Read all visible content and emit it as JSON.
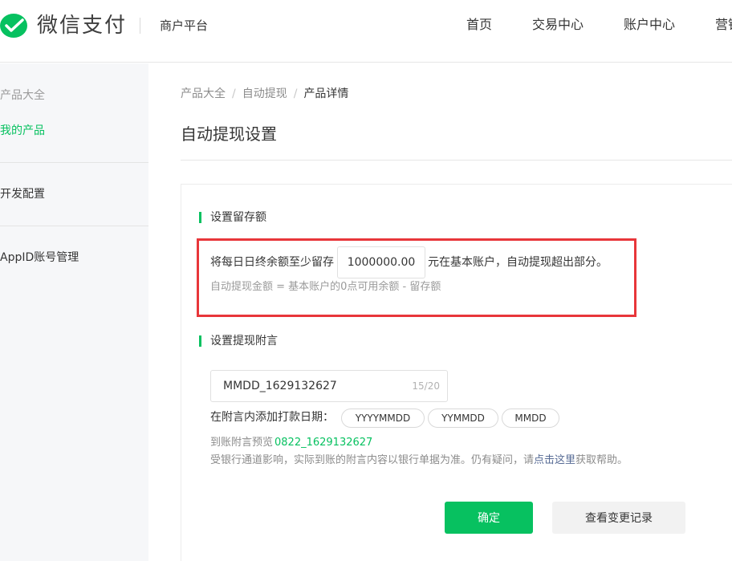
{
  "header": {
    "brand": "微信支付",
    "platform": "商户平台",
    "nav": [
      {
        "label": "首页"
      },
      {
        "label": "交易中心"
      },
      {
        "label": "账户中心"
      },
      {
        "label": "营销"
      }
    ],
    "logo_icon": "wechat-pay-logo-icon",
    "accent_color": "#07c160"
  },
  "sidebar": {
    "items": [
      {
        "label": "产品大全",
        "state": "muted"
      },
      {
        "label": "我的产品",
        "state": "active"
      },
      {
        "label": "开发配置",
        "state": "normal"
      },
      {
        "label": "AppID账号管理",
        "state": "normal"
      }
    ]
  },
  "breadcrumb": [
    {
      "label": "产品大全"
    },
    {
      "label": "自动提现"
    },
    {
      "label": "产品详情"
    }
  ],
  "page_title": "自动提现设置",
  "reserve": {
    "section_title": "设置留存额",
    "prefix": "将每日日终余额至少留存",
    "amount": "1000000.00",
    "suffix": "元在基本账户，自动提现超出部分。",
    "formula": "自动提现金额 = 基本账户的0点可用余额 - 留存额"
  },
  "memo": {
    "section_title": "设置提现附言",
    "value": "MMDD_1629132627",
    "count": "15/20",
    "date_label": "在附言内添加打款日期：",
    "date_options": [
      {
        "label": "YYYYMMDD"
      },
      {
        "label": "YYMMDD"
      },
      {
        "label": "MMDD"
      }
    ],
    "preview_label": "到账附言预览",
    "preview_value": "0822_1629132627",
    "help_prefix": "受银行通道影响，实际到账的附言内容以银行单据为准。仍有疑问，请",
    "help_link": "点击这里",
    "help_suffix": "获取帮助。"
  },
  "actions": {
    "confirm": "确定",
    "history": "查看变更记录"
  }
}
